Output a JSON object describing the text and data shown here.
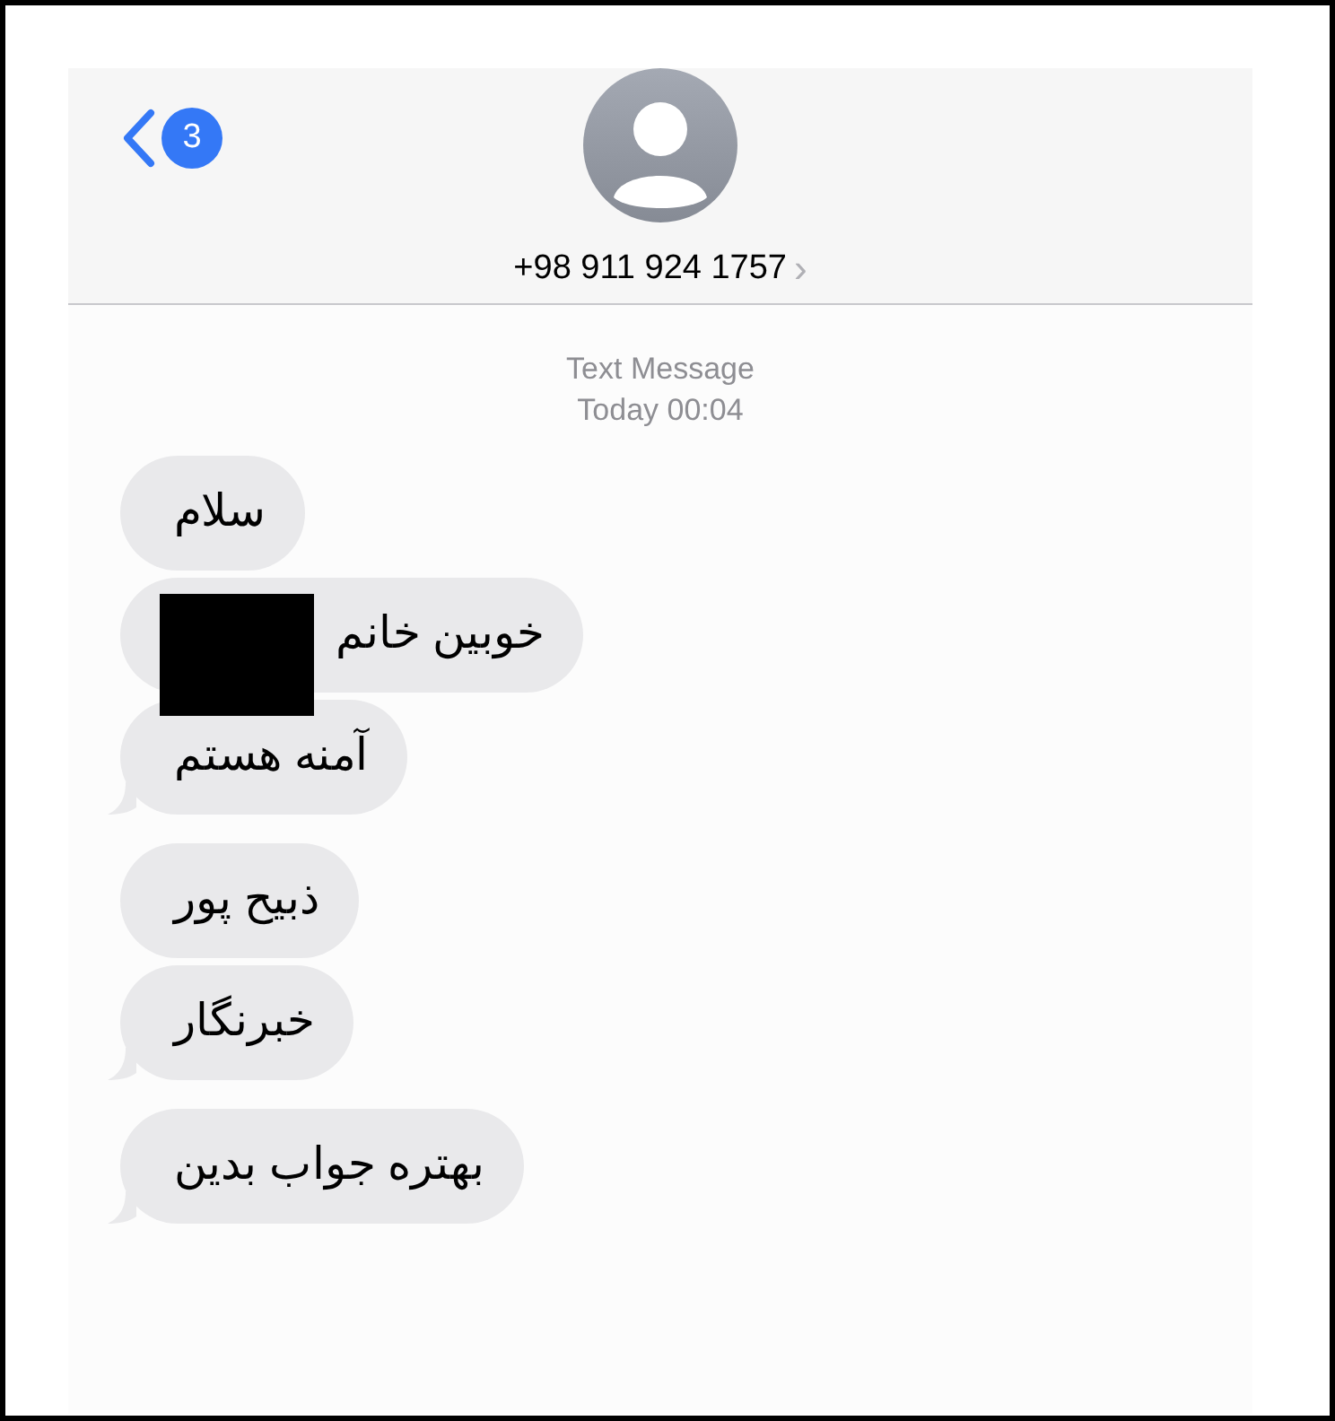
{
  "header": {
    "back_badge": "3",
    "contact": "+98 911 924 1757",
    "contact_chevron": "›"
  },
  "conversation": {
    "service": "Text Message",
    "timestamp": "Today 00:04"
  },
  "message_groups": [
    {
      "messages": [
        {
          "text": "سلام",
          "tail": false,
          "redacted": false
        },
        {
          "text": "خوبین خانم",
          "tail": false,
          "redacted": true
        },
        {
          "text": "آمنه هستم",
          "tail": true,
          "redacted": false
        }
      ]
    },
    {
      "messages": [
        {
          "text": "ذبیح پور",
          "tail": false,
          "redacted": false
        },
        {
          "text": "خبرنگار",
          "tail": true,
          "redacted": false
        }
      ]
    },
    {
      "messages": [
        {
          "text": "بهتره جواب بدین",
          "tail": true,
          "redacted": false
        }
      ]
    }
  ]
}
